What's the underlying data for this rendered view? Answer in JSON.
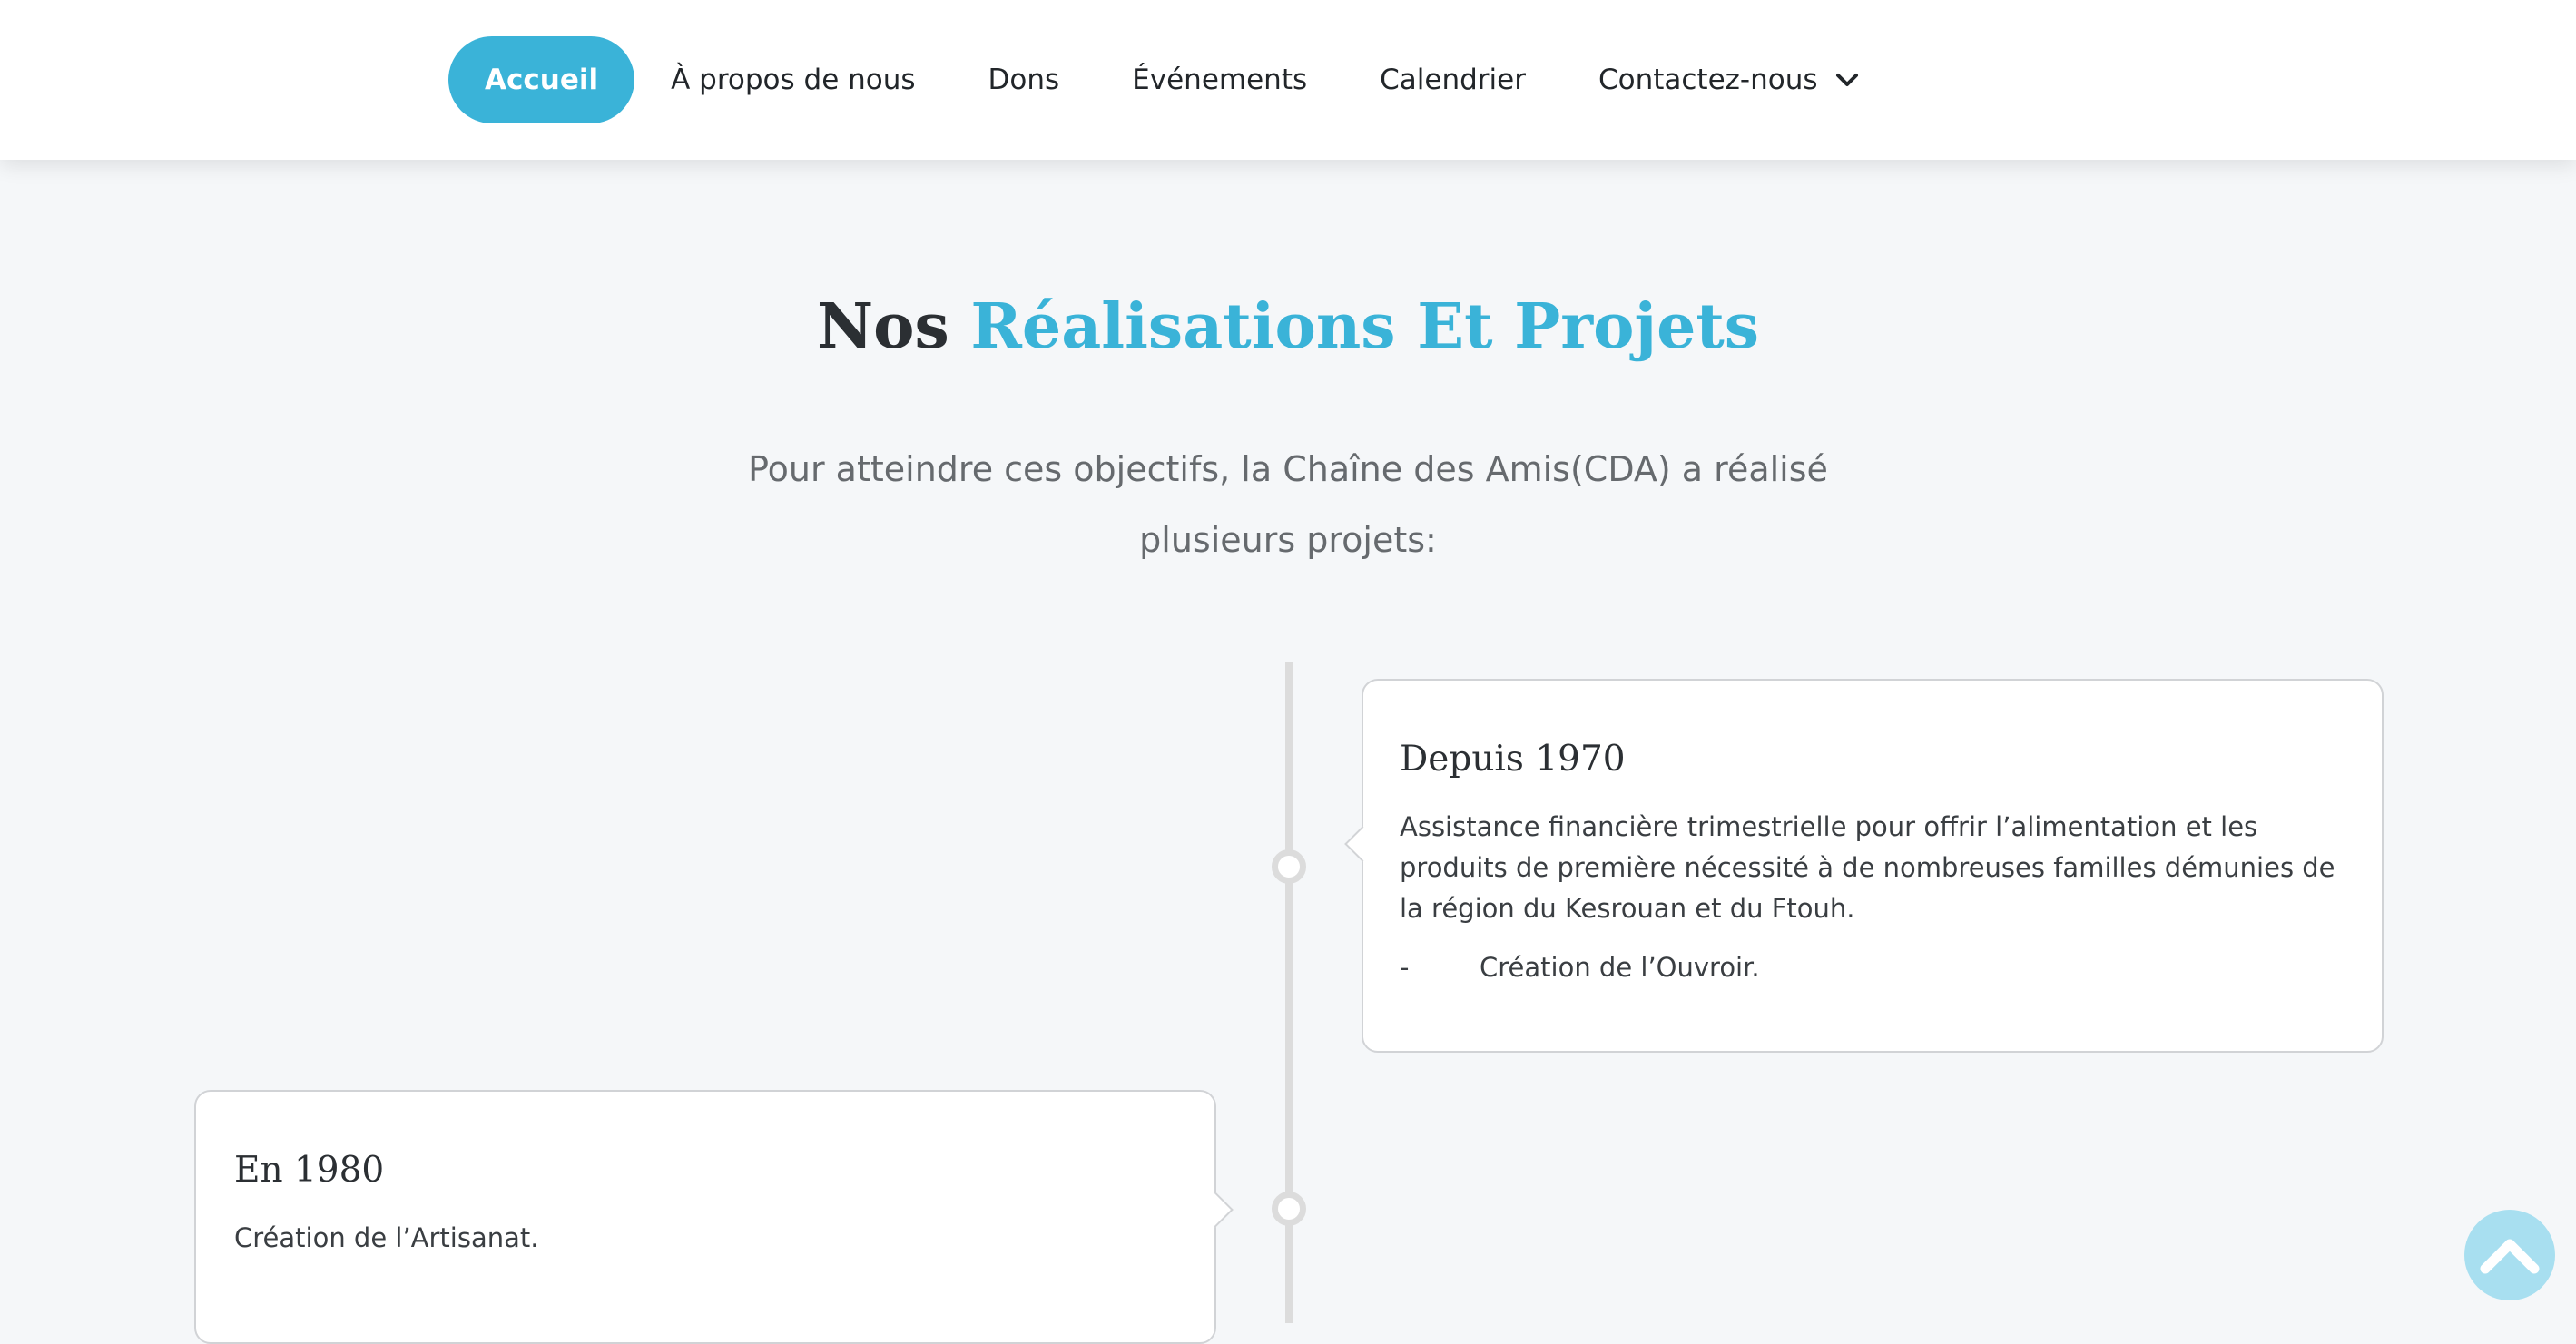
{
  "nav": {
    "items": [
      {
        "label": "Accueil",
        "active": true
      },
      {
        "label": "À propos de nous",
        "active": false
      },
      {
        "label": "Dons",
        "active": false
      },
      {
        "label": "Événements",
        "active": false
      },
      {
        "label": "Calendrier",
        "active": false
      },
      {
        "label": "Contactez-nous",
        "active": false,
        "icon": "chevron-down-icon"
      }
    ]
  },
  "section": {
    "title_plain": "Nos",
    "title_accent": "Réalisations Et Projets",
    "subtitle": "Pour atteindre ces objectifs, la Chaîne des Amis(CDA) a réalisé plusieurs projets:"
  },
  "timeline": [
    {
      "title": "Depuis 1970",
      "text": "Assistance financière trimestrielle pour offrir l’alimentation et les produits de première nécessité à de nombreuses familles démunies de la région du Kesrouan et du Ftouh.",
      "bullet_dash": "-",
      "bullet": "Création de l’Ouvroir."
    },
    {
      "title": "En 1980",
      "text": "Création de l’Artisanat."
    }
  ],
  "colors": {
    "accent": "#3ab3d8",
    "background": "#f5f7f9",
    "scroll_button": "#a8dff0"
  },
  "scroll_top": {
    "icon": "chevron-up-icon"
  }
}
